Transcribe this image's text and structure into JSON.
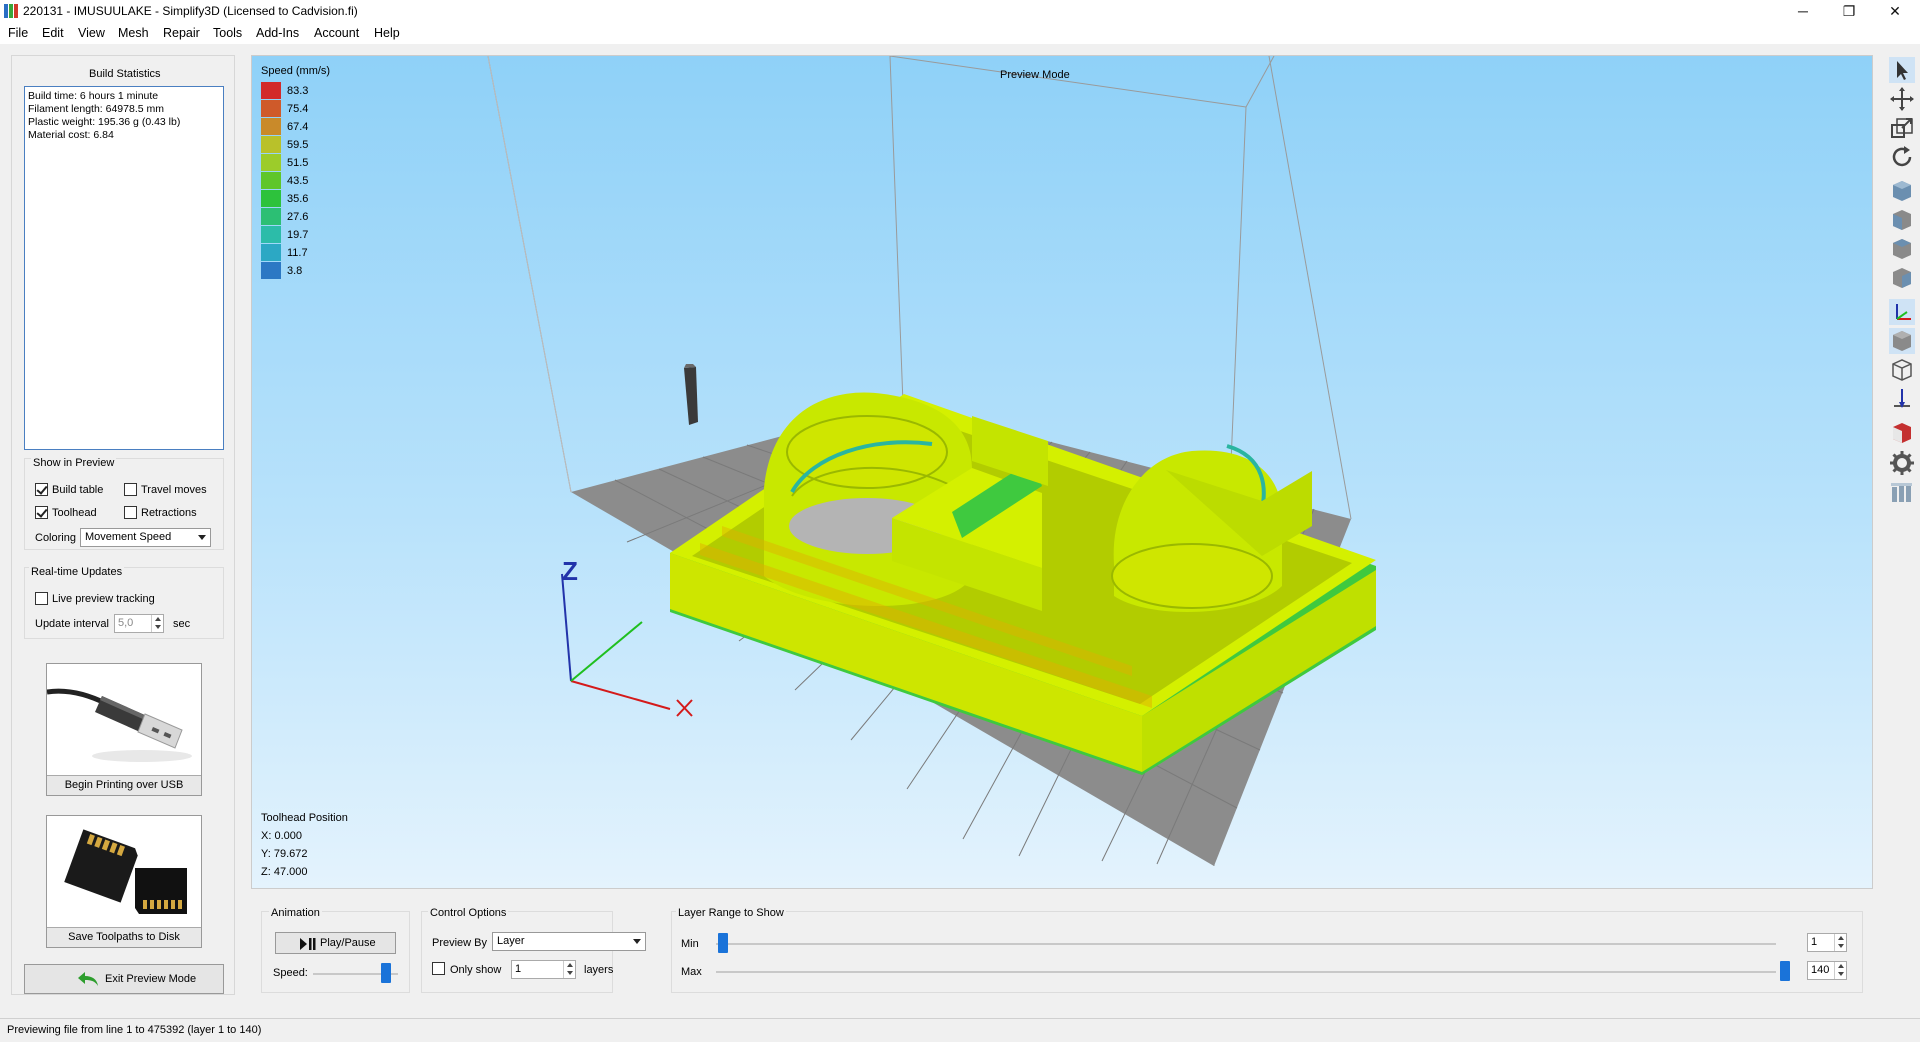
{
  "window": {
    "title": "220131 - IMUSUULAKE - Simplify3D (Licensed to Cadvision.fi)",
    "minimize": "─",
    "restore": "❐",
    "close": "✕"
  },
  "menu": [
    "File",
    "Edit",
    "View",
    "Mesh",
    "Repair",
    "Tools",
    "Add-Ins",
    "Account",
    "Help"
  ],
  "build_statistics": {
    "header": "Build Statistics",
    "lines": [
      "Build time: 6 hours 1 minute",
      "Filament length: 64978.5 mm",
      "Plastic weight: 195.36 g (0.43 lb)",
      "Material cost: 6.84"
    ]
  },
  "show_in_preview": {
    "header": "Show in Preview",
    "build_table": {
      "label": "Build table",
      "checked": true
    },
    "travel_moves": {
      "label": "Travel moves",
      "checked": false
    },
    "toolhead": {
      "label": "Toolhead",
      "checked": true
    },
    "retractions": {
      "label": "Retractions",
      "checked": false
    },
    "coloring_label": "Coloring",
    "coloring_value": "Movement Speed"
  },
  "realtime_updates": {
    "header": "Real-time Updates",
    "live_tracking": {
      "label": "Live preview tracking",
      "checked": false
    },
    "interval_label": "Update interval",
    "interval_value": "5,0",
    "interval_unit": "sec"
  },
  "actions": {
    "usb": "Begin Printing over USB",
    "disk": "Save Toolpaths to Disk",
    "exit": "Exit Preview Mode"
  },
  "viewport": {
    "mode_label": "Preview Mode",
    "legend_title": "Speed (mm/s)",
    "legend": [
      {
        "value": "83.3",
        "color": "#d22a2a"
      },
      {
        "value": "75.4",
        "color": "#cf5a2a"
      },
      {
        "value": "67.4",
        "color": "#c98a2a"
      },
      {
        "value": "59.5",
        "color": "#b9c12a"
      },
      {
        "value": "51.5",
        "color": "#9ccc2a"
      },
      {
        "value": "43.5",
        "color": "#5fc62a"
      },
      {
        "value": "35.6",
        "color": "#2dc23c"
      },
      {
        "value": "27.6",
        "color": "#2cbf74"
      },
      {
        "value": "19.7",
        "color": "#2cbca9"
      },
      {
        "value": "11.7",
        "color": "#2ca8c4"
      },
      {
        "value": "3.8",
        "color": "#2c78c4"
      }
    ],
    "toolhead_title": "Toolhead Position",
    "x": "X: 0.000",
    "y": "Y: 79.672",
    "z": "Z: 47.000",
    "axis_z": "Z",
    "model_color": "#d4f000",
    "table_color": "#8a8a8a"
  },
  "animation": {
    "header": "Animation",
    "play_label": "Play/Pause",
    "speed_label": "Speed:"
  },
  "control_options": {
    "header": "Control Options",
    "preview_by_label": "Preview By",
    "preview_by_value": "Layer",
    "only_show_label": "Only show",
    "only_show_value": "1",
    "layers_label": "layers"
  },
  "layer_range": {
    "header": "Layer Range to Show",
    "min_label": "Min",
    "max_label": "Max",
    "min_value": "1",
    "max_value": "140"
  },
  "status": "Previewing file from line 1 to 475392 (layer 1 to 140)",
  "right_tools": [
    "select-icon",
    "move-icon",
    "scale-icon",
    "rotate-icon",
    "view-default-icon",
    "view-front-icon",
    "view-top-icon",
    "view-side-icon",
    "axes-icon",
    "solid-view-icon",
    "wireframe-icon",
    "toolhead-icon",
    "cross-section-icon",
    "settings-gear-icon",
    "parts-icon"
  ]
}
